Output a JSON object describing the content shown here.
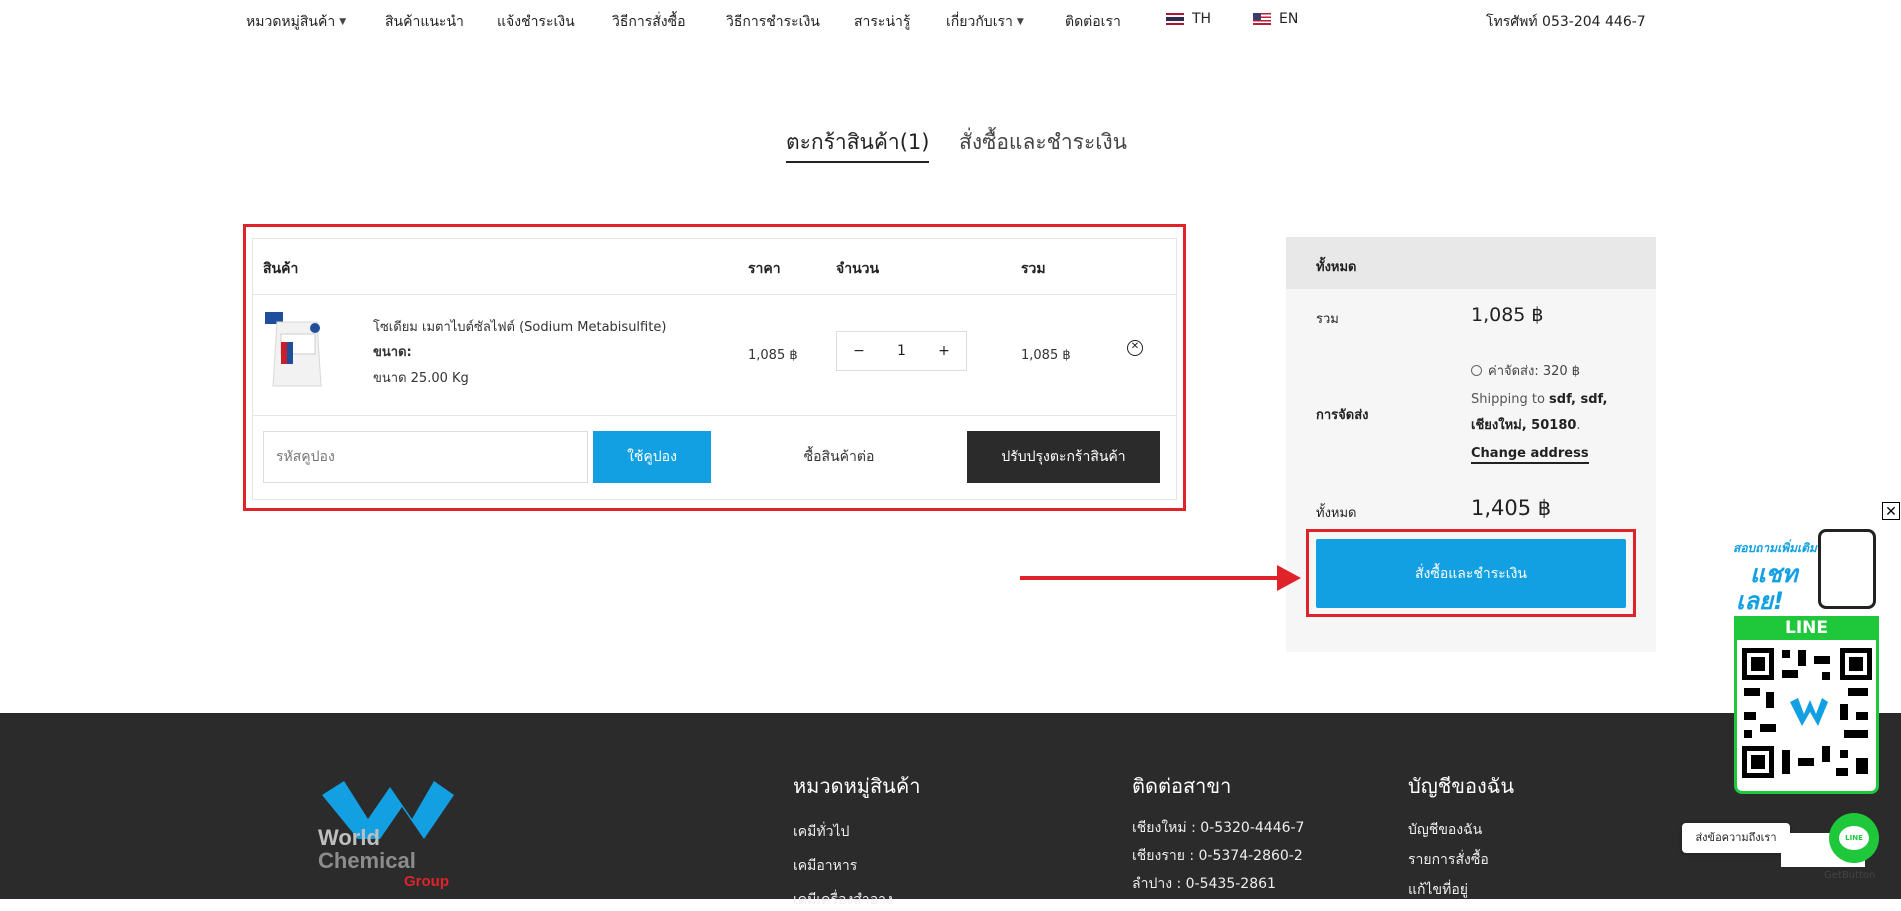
{
  "nav": {
    "items": [
      "หมวดหมู่สินค้า",
      "สินค้าแนะนำ",
      "แจ้งชำระเงิน",
      "วิธีการสั่งซื้อ",
      "วิธีการชำระเงิน",
      "สาระน่ารู้",
      "เกี่ยวกับเรา",
      "ติดต่อเรา"
    ],
    "lang_th": "TH",
    "lang_en": "EN",
    "phone": "โทรศัพท์ 053-204 446-7"
  },
  "tabs": {
    "cart": "ตะกร้าสินค้า(1)",
    "checkout": "สั่งซื้อและชำระเงิน"
  },
  "cart": {
    "headers": {
      "product": "สินค้า",
      "price": "ราคา",
      "qty": "จำนวน",
      "total": "รวม"
    },
    "item": {
      "name": "โซเดียม เมตาไบต์ซัลไฟต์ (Sodium Metabisulfite)",
      "size_label": "ขนาด:",
      "size_value": "ขนาด 25.00 Kg",
      "price": "1,085 ฿",
      "qty": "1",
      "minus": "−",
      "plus": "+",
      "total": "1,085 ฿"
    },
    "coupon_placeholder": "รหัสคูปอง",
    "apply_coupon": "ใช้คูปอง",
    "continue_shopping": "ซื้อสินค้าต่อ",
    "update_cart": "ปรับปรุงตะกร้าสินค้า"
  },
  "summary": {
    "title": "ทั้งหมด",
    "subtotal_label": "รวม",
    "subtotal_value": "1,085 ฿",
    "shipping_label": "การจัดส่ง",
    "shipping_option": "ค่าจัดส่ง: 320 ฿",
    "shipping_to_prefix": "Shipping to",
    "shipping_to_addr1": "sdf, sdf,",
    "shipping_to_addr2": "เชียงใหม่, 50180",
    "shipping_to_suffix": ".",
    "change_address": "Change address",
    "total_label": "ทั้งหมด",
    "total_value": "1,405 ฿",
    "checkout_button": "สั่งซื้อและชำระเงิน"
  },
  "footer": {
    "logo_world": "World",
    "logo_chemical": "Chemical",
    "logo_group": "Group",
    "col1_title": "หมวดหมู่สินค้า",
    "col1_links": [
      "เคมีทั่วไป",
      "เคมีอาหาร",
      "เคมีเครื่องสำอาง"
    ],
    "col2_title": "ติดต่อสาขา",
    "col2_links": [
      "เชียงใหม่ : 0-5320-4446-7",
      "เชียงราย : 0-5374-2860-2",
      "ลำปาง : 0-5435-2861"
    ],
    "col3_title": "บัญชีของฉัน",
    "col3_links": [
      "บัญชีของฉัน",
      "รายการสั่งซื้อ",
      "แก้ไขที่อยู่"
    ]
  },
  "widget": {
    "promo_line1": "สอบถามเพิ่มเติม",
    "promo_line2": "แชท",
    "promo_line3": "เลย!",
    "line_label": "LINE",
    "send_message": "ส่งข้อความถึงเรา",
    "line_icon_text": "LINE",
    "getbutton": "GetButton",
    "close": "✕"
  },
  "colors": {
    "accent": "#12a0e2",
    "highlight": "#e0232a",
    "dark_button": "#2b2b2b",
    "line_green": "#1fc73a"
  }
}
